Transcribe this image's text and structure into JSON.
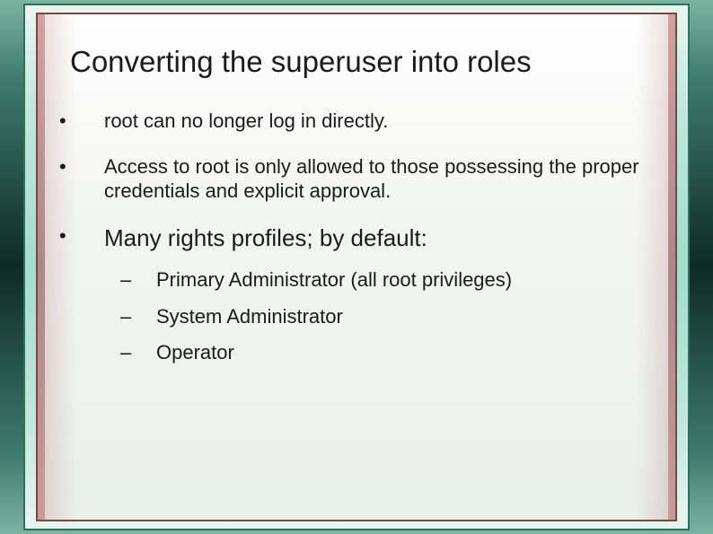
{
  "title": "Converting the superuser into roles",
  "bullets": [
    {
      "text": "root can no longer log in directly.",
      "size": "normal"
    },
    {
      "text": "Access to root is only allowed to those possessing the proper credentials and explicit approval.",
      "size": "normal"
    },
    {
      "text": "Many rights profiles; by default:",
      "size": "large",
      "sub": [
        "Primary Administrator (all root privileges)",
        "System Administrator",
        "Operator"
      ]
    }
  ]
}
